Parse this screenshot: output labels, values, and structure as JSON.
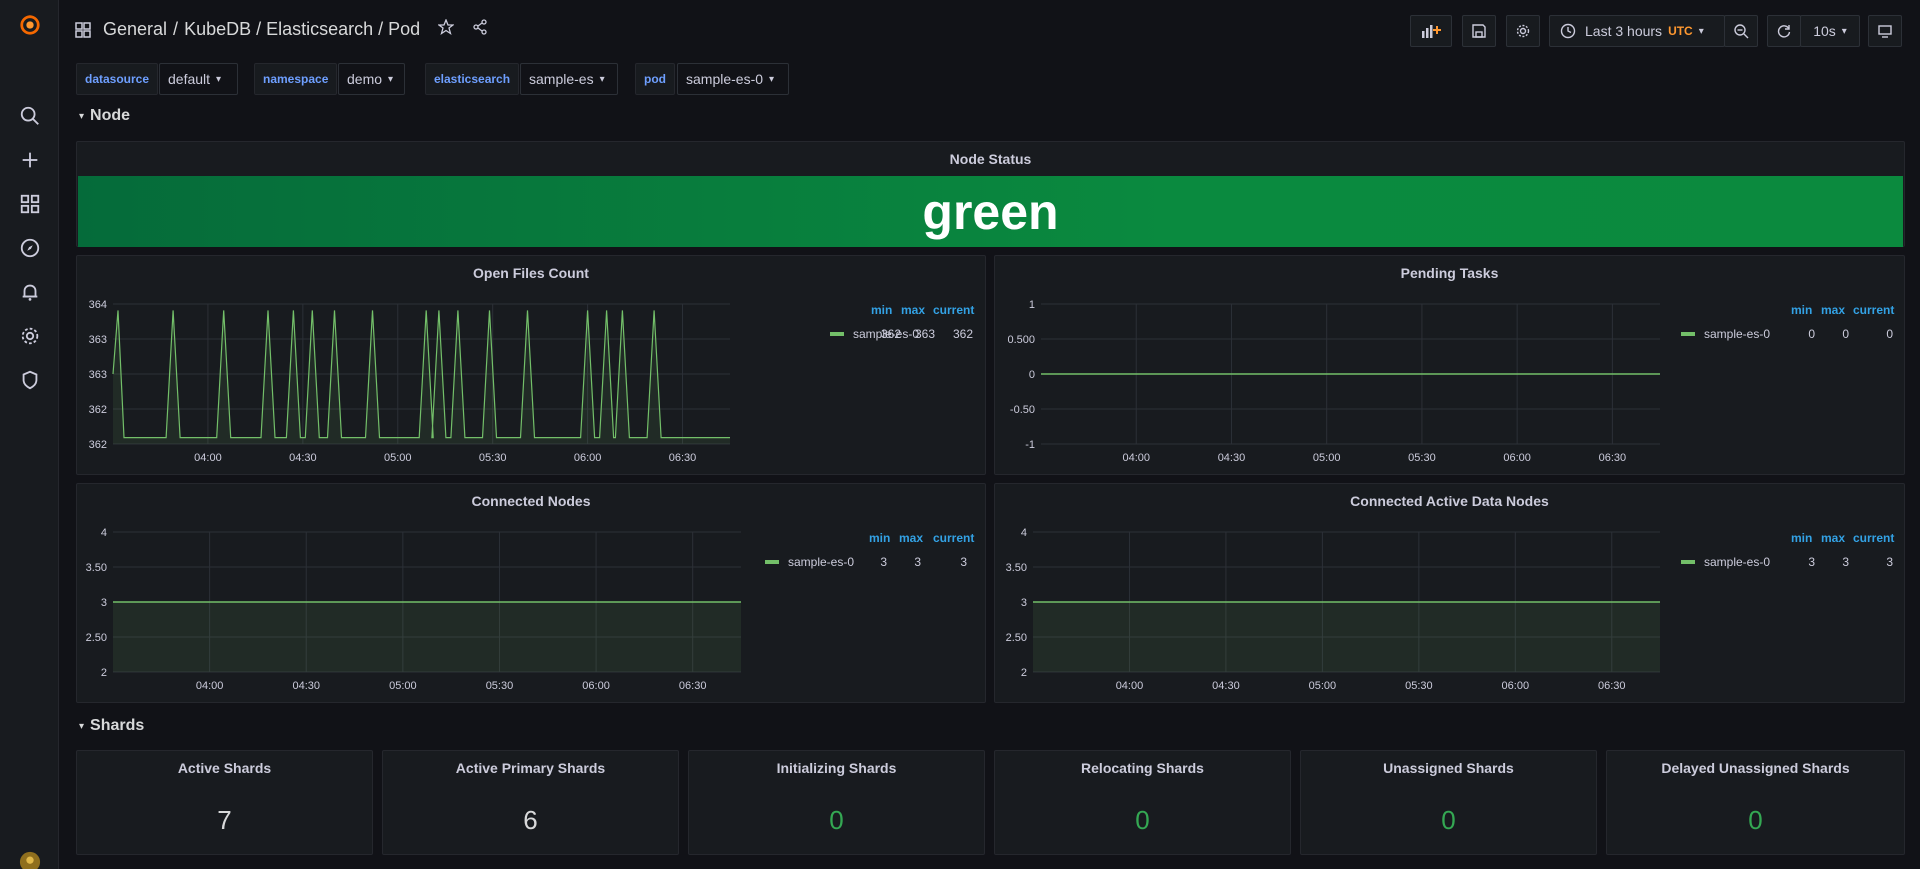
{
  "breadcrumb": {
    "folder": "General",
    "separator": "/",
    "title": "KubeDB / Elasticsearch / Pod"
  },
  "toolbar": {
    "time_range": "Last 3 hours",
    "timezone": "UTC",
    "refresh_interval": "10s"
  },
  "variables": [
    {
      "label": "datasource",
      "value": "default"
    },
    {
      "label": "namespace",
      "value": "demo"
    },
    {
      "label": "elasticsearch",
      "value": "sample-es"
    },
    {
      "label": "pod",
      "value": "sample-es-0"
    }
  ],
  "rows": {
    "node": "Node",
    "shards": "Shards"
  },
  "node_status": {
    "title": "Node Status",
    "value": "green"
  },
  "legend_headers": {
    "min": "min",
    "max": "max",
    "current": "current"
  },
  "time_ticks": [
    "04:00",
    "04:30",
    "05:00",
    "05:30",
    "06:00",
    "06:30"
  ],
  "colors": {
    "series": "#73bf69",
    "status_green": "#0a8a3f",
    "legend_header": "#33a2e5",
    "stat_green": "#34a853"
  },
  "graphs": [
    {
      "id": "open_files",
      "title": "Open Files Count",
      "y_ticks": [
        "364",
        "363",
        "363",
        "362",
        "362"
      ],
      "legend": {
        "name": "sample-es-0",
        "min": "362",
        "max": "363",
        "current": "362"
      }
    },
    {
      "id": "pending_tasks",
      "title": "Pending Tasks",
      "y_ticks": [
        "1",
        "0.500",
        "0",
        "-0.50",
        "-1"
      ],
      "legend": {
        "name": "sample-es-0",
        "min": "0",
        "max": "0",
        "current": "0"
      }
    },
    {
      "id": "connected_nodes",
      "title": "Connected Nodes",
      "y_ticks": [
        "4",
        "3.50",
        "3",
        "2.50",
        "2"
      ],
      "legend": {
        "name": "sample-es-0",
        "min": "3",
        "max": "3",
        "current": "3"
      }
    },
    {
      "id": "active_data_nodes",
      "title": "Connected Active Data Nodes",
      "y_ticks": [
        "4",
        "3.50",
        "3",
        "2.50",
        "2"
      ],
      "legend": {
        "name": "sample-es-0",
        "min": "3",
        "max": "3",
        "current": "3"
      }
    }
  ],
  "chart_data": [
    {
      "type": "area",
      "title": "Open Files Count",
      "series": [
        {
          "name": "sample-es-0",
          "baseline": 362,
          "spike_value": 363,
          "spike_times": [
            "03:32",
            "03:49",
            "04:05",
            "04:19",
            "04:27",
            "04:33",
            "04:40",
            "04:52",
            "05:09",
            "05:13",
            "05:19",
            "05:29",
            "05:41",
            "06:00",
            "06:06",
            "06:11",
            "06:21"
          ]
        }
      ],
      "ylim": [
        361.95,
        363.05
      ]
    },
    {
      "type": "line",
      "title": "Pending Tasks",
      "series": [
        {
          "name": "sample-es-0",
          "value": 0
        }
      ],
      "ylim": [
        -1,
        1
      ]
    },
    {
      "type": "area",
      "title": "Connected Nodes",
      "series": [
        {
          "name": "sample-es-0",
          "value": 3
        }
      ],
      "ylim": [
        2,
        4
      ]
    },
    {
      "type": "area",
      "title": "Connected Active Data Nodes",
      "series": [
        {
          "name": "sample-es-0",
          "value": 3
        }
      ],
      "ylim": [
        2,
        4
      ]
    }
  ],
  "shard_stats": [
    {
      "title": "Active Shards",
      "value": "7",
      "color": "white"
    },
    {
      "title": "Active Primary Shards",
      "value": "6",
      "color": "white"
    },
    {
      "title": "Initializing Shards",
      "value": "0",
      "color": "green"
    },
    {
      "title": "Relocating Shards",
      "value": "0",
      "color": "green"
    },
    {
      "title": "Unassigned Shards",
      "value": "0",
      "color": "green"
    },
    {
      "title": "Delayed Unassigned Shards",
      "value": "0",
      "color": "green"
    }
  ]
}
